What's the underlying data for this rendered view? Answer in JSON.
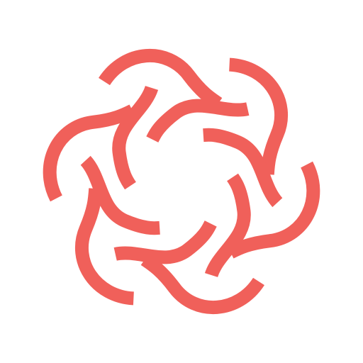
{
  "logo": {
    "icon": "interlaced-six-strand-knot-icon",
    "strand_count": 6,
    "colors": {
      "strand": "#f0605a",
      "background": "#ffffff"
    }
  }
}
